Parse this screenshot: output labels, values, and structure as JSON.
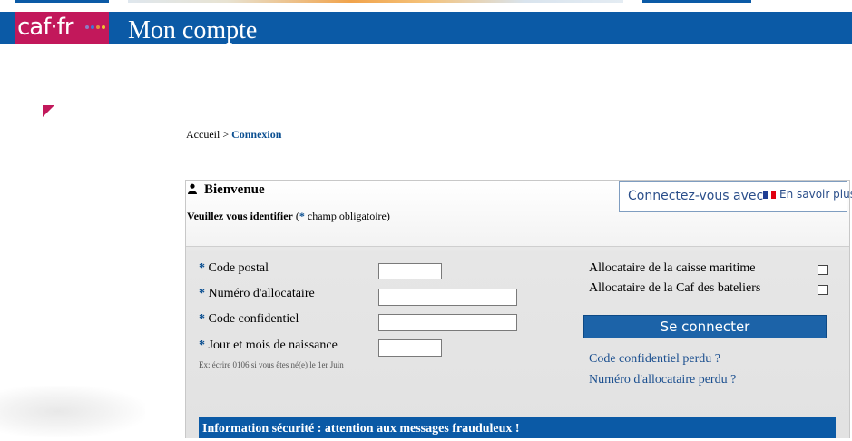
{
  "brand": {
    "logo_text": "caf·fr",
    "color": "#0b5aa6",
    "logo_color": "#c2185b"
  },
  "header": {
    "title": "Mon compte"
  },
  "breadcrumb": {
    "home": "Accueil",
    "separator": " > ",
    "current": "Connexion"
  },
  "panel": {
    "welcome": "Bienvenue",
    "identify_label": "Veuillez vous identifier",
    "identify_rest_open": " (",
    "required_star": "*",
    "identify_rest_close": " champ obligatoire)"
  },
  "franceconnect": {
    "label": "Connectez-vous avec",
    "more": "En savoir plus",
    "icon": "france-connect-icon"
  },
  "form": {
    "fields": [
      {
        "star": "*",
        "label": " Code postal",
        "value": ""
      },
      {
        "star": "*",
        "label": " Numéro d'allocataire",
        "value": ""
      },
      {
        "star": "*",
        "label": " Code confidentiel",
        "value": ""
      },
      {
        "star": "*",
        "label": " Jour et mois de naissance",
        "value": ""
      }
    ],
    "hint": "Ex: écrire 0106 si vous êtes né(e) le 1er Juin"
  },
  "options": {
    "maritime": {
      "label": "Allocataire de la caisse maritime",
      "checked": false
    },
    "bateliers": {
      "label": "Allocataire de la Caf des bateliers",
      "checked": false
    }
  },
  "actions": {
    "connect": "Se connecter",
    "lost_code": "Code confidentiel perdu ?",
    "lost_number": "Numéro d'allocataire perdu ?"
  },
  "alert": {
    "text": "Information sécurité : attention aux messages frauduleux !"
  }
}
